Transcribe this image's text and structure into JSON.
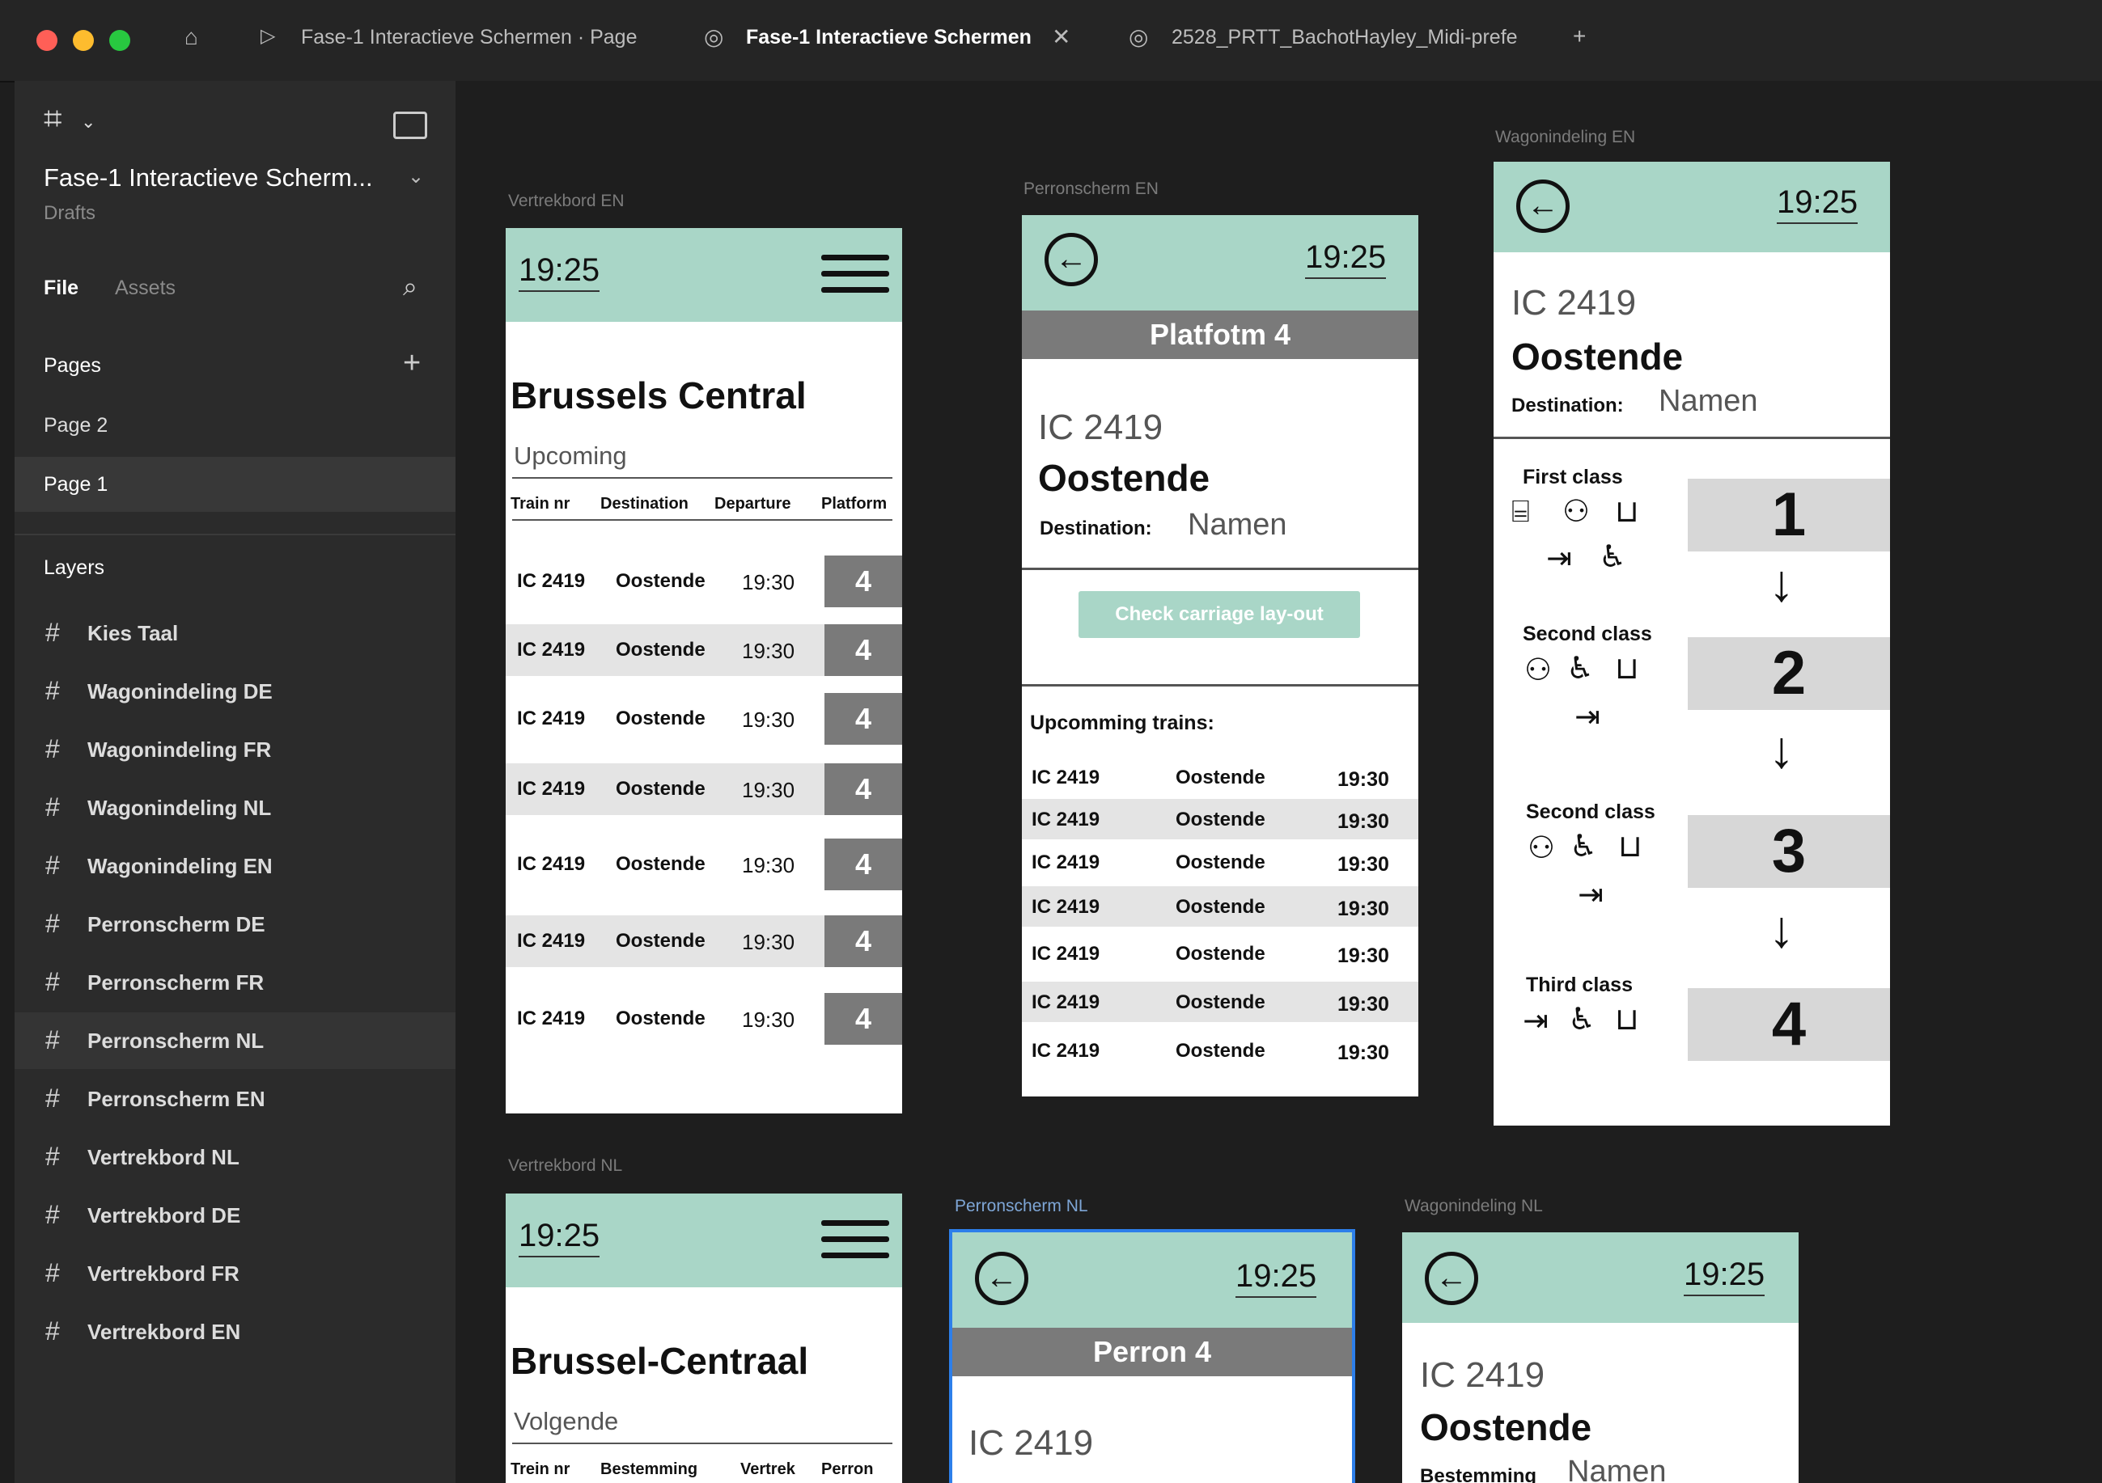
{
  "titlebar": {
    "tabs": [
      "Fase-1 Interactieve Schermen · Page",
      "Fase-1 Interactieve Schermen",
      "2528_PRTT_BachotHayley_Midi-prefe"
    ],
    "active_tab": "Fase-1 Interactieve Schermen",
    "colors": {
      "close": "#ff5f57",
      "min": "#febc2e",
      "max": "#28c840"
    }
  },
  "sidebar": {
    "file_name": "Fase-1 Interactieve Scherm...",
    "location": "Drafts",
    "file_tab": "File",
    "assets_tab": "Assets",
    "pages_heading": "Pages",
    "pages": [
      "Page 2",
      "Page 1"
    ],
    "layers_heading": "Layers",
    "layers": [
      "Kies Taal",
      "Wagonindeling DE",
      "Wagonindeling FR",
      "Wagonindeling NL",
      "Wagonindeling EN",
      "Perronscherm DE",
      "Perronscherm FR",
      "Perronscherm NL",
      "Perronscherm EN",
      "Vertrekbord NL",
      "Vertrekbord DE",
      "Vertrekbord FR",
      "Vertrekbord EN"
    ]
  },
  "frames": {
    "vertrek_en": {
      "label": "Vertrekbord EN",
      "time": "19:25",
      "station": "Brussels Central",
      "subheading": "Upcoming",
      "headers": [
        "Train nr",
        "Destination",
        "Departure",
        "Platform"
      ],
      "rows": [
        {
          "train": "IC 2419",
          "dest": "Oostende",
          "time": "19:30",
          "platform": "4"
        },
        {
          "train": "IC 2419",
          "dest": "Oostende",
          "time": "19:30",
          "platform": "4"
        },
        {
          "train": "IC 2419",
          "dest": "Oostende",
          "time": "19:30",
          "platform": "4"
        },
        {
          "train": "IC 2419",
          "dest": "Oostende",
          "time": "19:30",
          "platform": "4"
        },
        {
          "train": "IC 2419",
          "dest": "Oostende",
          "time": "19:30",
          "platform": "4"
        },
        {
          "train": "IC 2419",
          "dest": "Oostende",
          "time": "19:30",
          "platform": "4"
        },
        {
          "train": "IC 2419",
          "dest": "Oostende",
          "time": "19:30",
          "platform": "4"
        }
      ]
    },
    "perron_en": {
      "label": "Perronscherm EN",
      "time": "19:25",
      "platform": "Platfotm 4",
      "train": "IC 2419",
      "destination": "Oostende",
      "dest_label": "Destination:",
      "dest_value": "Namen",
      "button": "Check carriage lay-out",
      "upcoming": "Upcomming trains:",
      "rows": [
        {
          "train": "IC 2419",
          "dest": "Oostende",
          "time": "19:30"
        },
        {
          "train": "IC 2419",
          "dest": "Oostende",
          "time": "19:30"
        },
        {
          "train": "IC 2419",
          "dest": "Oostende",
          "time": "19:30"
        },
        {
          "train": "IC 2419",
          "dest": "Oostende",
          "time": "19:30"
        },
        {
          "train": "IC 2419",
          "dest": "Oostende",
          "time": "19:30"
        },
        {
          "train": "IC 2419",
          "dest": "Oostende",
          "time": "19:30"
        },
        {
          "train": "IC 2419",
          "dest": "Oostende",
          "time": "19:30"
        }
      ]
    },
    "wagon_en": {
      "label": "Wagonindeling EN",
      "time": "19:25",
      "train": "IC 2419",
      "destination": "Oostende",
      "dest_label": "Destination:",
      "dest_value": "Namen",
      "wagons": [
        {
          "class": "First class",
          "num": "1"
        },
        {
          "class": "Second class",
          "num": "2"
        },
        {
          "class": "Second class",
          "num": "3"
        },
        {
          "class": "Third class",
          "num": "4"
        }
      ]
    },
    "vertrek_nl": {
      "label": "Vertrekbord NL",
      "time": "19:25",
      "station": "Brussel-Centraal",
      "subheading": "Volgende",
      "headers": [
        "Trein nr",
        "Bestemming",
        "Vertrek",
        "Perron"
      ]
    },
    "perron_nl": {
      "label": "Perronscherm NL",
      "time": "19:25",
      "platform": "Perron 4",
      "train": "IC 2419"
    },
    "wagon_nl": {
      "label": "Wagonindeling NL",
      "time": "19:25",
      "train": "IC 2419",
      "destination": "Oostende",
      "dest_label": "Bestemming",
      "dest_value": "Namen"
    }
  },
  "colors": {
    "accent": "#a9d6c7",
    "platform": "#7a7a7a",
    "selection": "#2d7fea"
  }
}
